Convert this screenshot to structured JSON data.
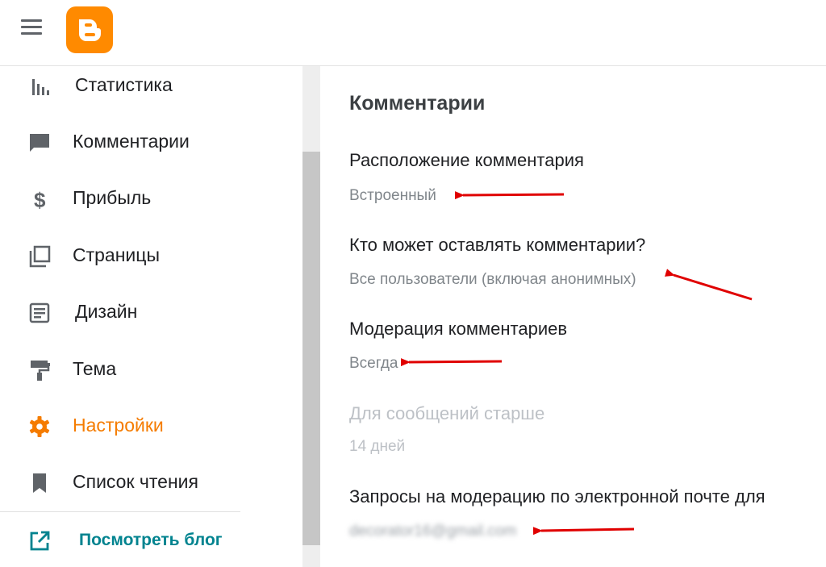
{
  "sidebar": {
    "items": [
      {
        "label": "Статистика",
        "icon": "bar-chart-icon"
      },
      {
        "label": "Комментарии",
        "icon": "comment-icon"
      },
      {
        "label": "Прибыль",
        "icon": "dollar-icon"
      },
      {
        "label": "Страницы",
        "icon": "pages-icon"
      },
      {
        "label": "Дизайн",
        "icon": "layout-icon"
      },
      {
        "label": "Тема",
        "icon": "paint-roller-icon"
      },
      {
        "label": "Настройки",
        "icon": "gear-icon"
      },
      {
        "label": "Список чтения",
        "icon": "bookmark-icon"
      }
    ],
    "view_blog": {
      "label": "Посмотреть блог",
      "icon": "open-in-new-icon"
    }
  },
  "main": {
    "section_title": "Комментарии",
    "settings": [
      {
        "label": "Расположение комментария",
        "value": "Встроенный"
      },
      {
        "label": "Кто может оставлять комментарии?",
        "value": "Все пользователи (включая анонимных)"
      },
      {
        "label": "Модерация комментариев",
        "value": "Всегда"
      },
      {
        "label": "Для сообщений старше",
        "value": "14 дней"
      },
      {
        "label": "Запросы на модерацию по электронной почте для",
        "value": "decorator16@gmail.com"
      }
    ]
  },
  "colors": {
    "accent": "#f57c00",
    "link": "#00838f",
    "logo": "#ff8a00",
    "annotation": "#e00000"
  }
}
